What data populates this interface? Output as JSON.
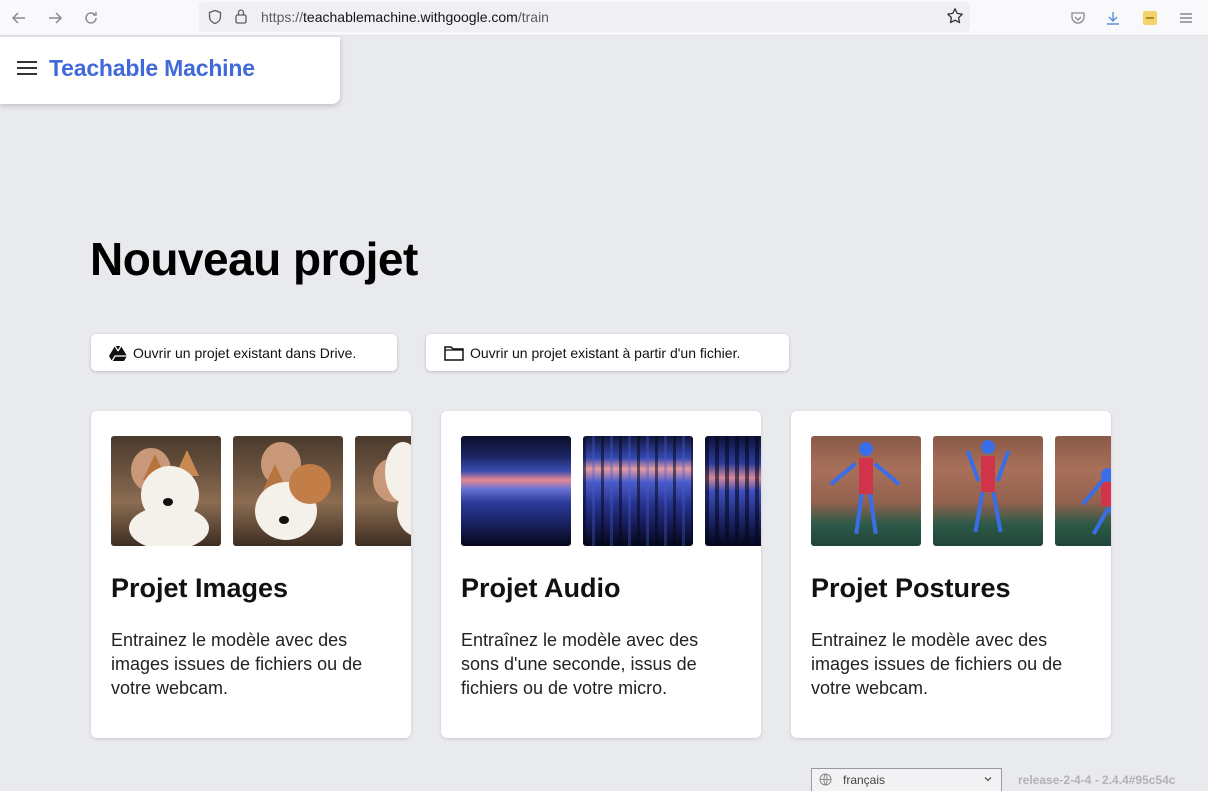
{
  "browser": {
    "url_prefix": "https://",
    "url_host": "teachablemachine.withgoogle.com",
    "url_path": "/train",
    "icons": [
      "back-arrow-icon",
      "forward-arrow-icon",
      "reload-icon",
      "shield-icon",
      "lock-icon",
      "star-icon",
      "pocket-icon",
      "download-icon",
      "extension-icon",
      "hamburger-menu-icon"
    ]
  },
  "header": {
    "title": "Teachable Machine",
    "title_color": "#4169d9"
  },
  "main": {
    "title": "Nouveau projet",
    "open_drive_label": "Ouvrir un projet existant dans Drive.",
    "open_file_label": "Ouvrir un projet existant à partir d'un fichier."
  },
  "cards": [
    {
      "title": "Projet Images",
      "description": "Entrainez le modèle avec des images issues de fichiers ou de votre webcam."
    },
    {
      "title": "Projet Audio",
      "description": "Entraînez le modèle avec des sons d'une seconde, issus de fichiers ou de votre micro."
    },
    {
      "title": "Projet Postures",
      "description": "Entrainez le modèle avec des images issues de fichiers ou de votre webcam."
    }
  ],
  "footer": {
    "language": "français",
    "release": "release-2-4-4 - 2.4.4#95c54c"
  }
}
